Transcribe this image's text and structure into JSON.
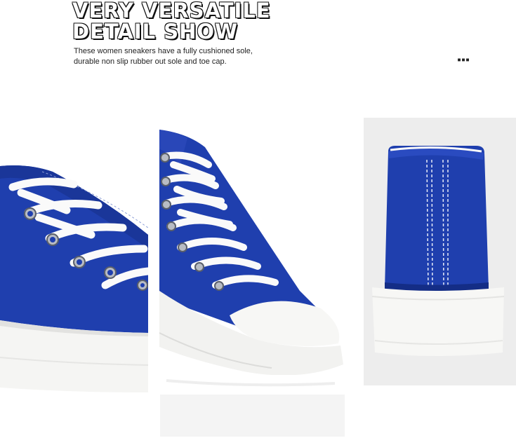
{
  "heading": {
    "line1": "VERY VERSATILE",
    "line2": "DETAIL SHOW"
  },
  "description": {
    "line1": "These women sneakers have a fully cushioned sole,",
    "line2": "durable non slip rubber out sole and toe cap."
  },
  "corner_mark": "▪▪▪",
  "colors": {
    "canvas": "#1f3fae",
    "canvas_dark": "#142d86",
    "sole": "#f5f5f3",
    "lace": "#fafafa",
    "eyelet": "#b8bcc4",
    "background": "#ffffff",
    "panel_gray": "#ededed"
  },
  "images": [
    {
      "name": "side-laces-closeup"
    },
    {
      "name": "toe-cap-closeup"
    },
    {
      "name": "heel-back-view"
    }
  ]
}
